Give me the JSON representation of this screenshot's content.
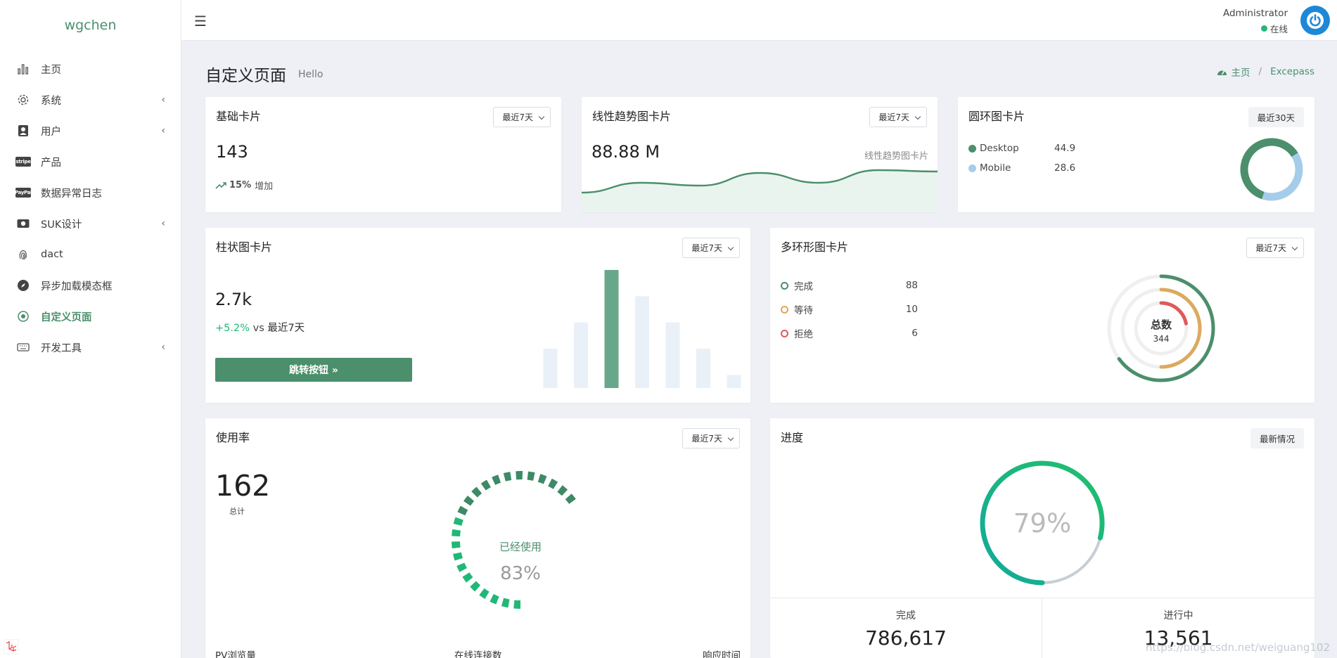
{
  "brand": "wgchen",
  "sidebar": {
    "items": [
      {
        "label": "主页",
        "icon": "bar-chart-icon",
        "has_arrow": false
      },
      {
        "label": "系统",
        "icon": "gear-icon",
        "has_arrow": true
      },
      {
        "label": "用户",
        "icon": "user-icon",
        "has_arrow": true
      },
      {
        "label": "产品",
        "icon": "stripe-icon",
        "has_arrow": false
      },
      {
        "label": "数据异常日志",
        "icon": "paypal-icon",
        "has_arrow": false
      },
      {
        "label": "SUK设计",
        "icon": "money-icon",
        "has_arrow": true
      },
      {
        "label": "dact",
        "icon": "fingerprint-icon",
        "has_arrow": false
      },
      {
        "label": "异步加载模态框",
        "icon": "compass-icon",
        "has_arrow": false
      },
      {
        "label": "自定义页面",
        "icon": "target-icon",
        "has_arrow": false,
        "active": true
      },
      {
        "label": "开发工具",
        "icon": "keyboard-icon",
        "has_arrow": true
      }
    ],
    "arrow": "‹"
  },
  "topbar": {
    "user_name": "Administrator",
    "status": "在线"
  },
  "page": {
    "title": "自定义页面",
    "subtitle": "Hello",
    "breadcrumb_home": "主页",
    "breadcrumb_sep": "/",
    "breadcrumb_current": "Excepass"
  },
  "cards": {
    "basic": {
      "title": "基础卡片",
      "dropdown": "最近7天",
      "value": "143",
      "trend": "15%",
      "trend_text": "增加"
    },
    "line": {
      "title": "线性趋势图卡片",
      "dropdown": "最近7天",
      "value": "88.88 M",
      "caption": "线性趋势图卡片"
    },
    "donut": {
      "title": "圆环图卡片",
      "button": "最近30天",
      "items": [
        {
          "label": "Desktop",
          "value": "44.9",
          "color": "#4b8f6c"
        },
        {
          "label": "Mobile",
          "value": "28.6",
          "color": "#a5cdea"
        }
      ]
    },
    "bar": {
      "title": "柱状图卡片",
      "dropdown": "最近7天",
      "value": "2.7k",
      "change": "+5.2%",
      "vs_text": "vs",
      "period": "最近7天",
      "button": "跳转按钮 »"
    },
    "multi": {
      "title": "多环形图卡片",
      "dropdown": "最近7天",
      "items": [
        {
          "label": "完成",
          "value": "88",
          "color": "#4b8f6c"
        },
        {
          "label": "等待",
          "value": "10",
          "color": "#dca95d"
        },
        {
          "label": "拒绝",
          "value": "6",
          "color": "#e0595b"
        }
      ],
      "center_label": "总数",
      "center_value": "344"
    },
    "usage": {
      "title": "使用率",
      "dropdown": "最近7天",
      "value": "162",
      "value_label": "总计",
      "gauge_label": "已经使用",
      "gauge_value": "83%",
      "gauge_pct": 83,
      "footer": [
        "PV浏览量",
        "在线连接数",
        "响应时间"
      ]
    },
    "progress": {
      "title": "进度",
      "button": "最新情况",
      "percent_text": "79%",
      "percent": 79,
      "stats": [
        {
          "label": "完成",
          "value": "786,617"
        },
        {
          "label": "进行中",
          "value": "13,561"
        }
      ]
    }
  },
  "chart_data": [
    {
      "type": "bar",
      "title": "",
      "values": [
        15,
        25,
        45,
        35,
        25,
        15,
        5
      ],
      "highlight_index": 2,
      "colors": {
        "bar": "#e9f0f8",
        "highlight": "#68a88a"
      }
    },
    {
      "type": "area",
      "title": "",
      "values": [
        0.2,
        0.55,
        0.45,
        0.9,
        0.55,
        1.0,
        0.95
      ],
      "color": "#4b8f6c",
      "fill": "#eaf4ee"
    },
    {
      "type": "pie",
      "title": "",
      "slices": [
        {
          "label": "Desktop",
          "value": 44.9
        },
        {
          "label": "Mobile",
          "value": 28.6
        }
      ]
    },
    {
      "type": "pie",
      "title": "",
      "slices": [
        {
          "label": "完成",
          "value": 88
        },
        {
          "label": "等待",
          "value": 10
        },
        {
          "label": "拒绝",
          "value": 6
        }
      ]
    }
  ],
  "watermark": "https://blog.csdn.net/weiguang102"
}
